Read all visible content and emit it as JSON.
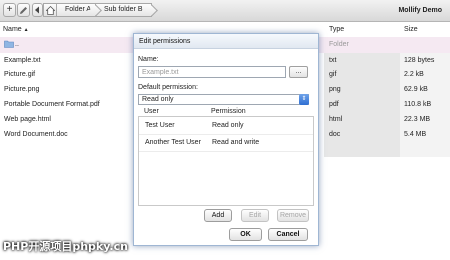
{
  "toolbar": {
    "add_icon": "plus-icon",
    "edit_icon": "pencil-icon",
    "back_icon": "back-arrow-icon",
    "home_icon": "home-icon",
    "breadcrumb": [
      "Folder A",
      "Sub folder B"
    ],
    "app_name": "Mollify Demo"
  },
  "columns": {
    "name": "Name",
    "sort_indicator": "▲",
    "type": "Type",
    "size": "Size"
  },
  "files": [
    {
      "name": "..",
      "type": "Folder",
      "size": "",
      "is_parent": true
    },
    {
      "name": "Example.txt",
      "type": "txt",
      "size": "128 bytes"
    },
    {
      "name": "Picture.gif",
      "type": "gif",
      "size": "2.2 kB"
    },
    {
      "name": "Picture.png",
      "type": "png",
      "size": "62.9 kB"
    },
    {
      "name": "Portable Document Format.pdf",
      "type": "pdf",
      "size": "110.8 kB"
    },
    {
      "name": "Web page.html",
      "type": "html",
      "size": "22.3 MB"
    },
    {
      "name": "Word Document.doc",
      "type": "doc",
      "size": "5.4 MB"
    }
  ],
  "dialog": {
    "title": "Edit permissions",
    "name_label": "Name:",
    "name_placeholder": "Example.txt",
    "browse_label": "...",
    "default_permission_label": "Default permission:",
    "default_permission_value": "Read only",
    "table_headers": {
      "user": "User",
      "permission": "Permission"
    },
    "permissions": [
      {
        "user": "Test User",
        "permission": "Read only"
      },
      {
        "user": "Another Test User",
        "permission": "Read and write"
      }
    ],
    "buttons": {
      "add": "Add",
      "edit": "Edit",
      "remove": "Remove",
      "ok": "OK",
      "cancel": "Cancel"
    }
  },
  "watermark": "PHP开源项目phpky.cn",
  "colors": {
    "parent_row": "#f5e9f2",
    "type_column": "#e7e7e7",
    "select_accent": "#3a78d8",
    "dialog_border": "#9fb6d3"
  }
}
